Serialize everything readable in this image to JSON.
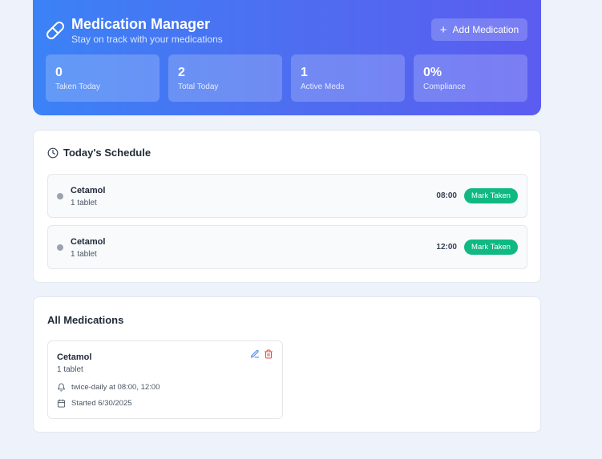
{
  "header": {
    "title": "Medication Manager",
    "subtitle": "Stay on track with your medications",
    "add_button": {
      "icon": "plus-icon",
      "label": "Add Medication"
    },
    "icon": "pill-icon",
    "gradient": [
      "#3b82f6",
      "#5b5cf0"
    ]
  },
  "stats": [
    {
      "value": "0",
      "label": "Taken Today"
    },
    {
      "value": "2",
      "label": "Total Today"
    },
    {
      "value": "1",
      "label": "Active Meds"
    },
    {
      "value": "0%",
      "label": "Compliance"
    }
  ],
  "schedule": {
    "title": "Today's Schedule",
    "icon": "clock-icon",
    "items": [
      {
        "name": "Cetamol",
        "dosage": "1 tablet",
        "time": "08:00",
        "action": "Mark Taken"
      },
      {
        "name": "Cetamol",
        "dosage": "1 tablet",
        "time": "12:00",
        "action": "Mark Taken"
      }
    ],
    "status_color": "#9ca3af",
    "action_color": "#10b981"
  },
  "medications": {
    "title": "All Medications",
    "items": [
      {
        "name": "Cetamol",
        "dosage": "1 tablet",
        "frequency": "twice-daily at 08:00, 12:00",
        "started": "Started 6/30/2025",
        "icons": [
          "bell-icon",
          "calendar-icon",
          "edit-icon",
          "trash-icon"
        ]
      }
    ]
  }
}
